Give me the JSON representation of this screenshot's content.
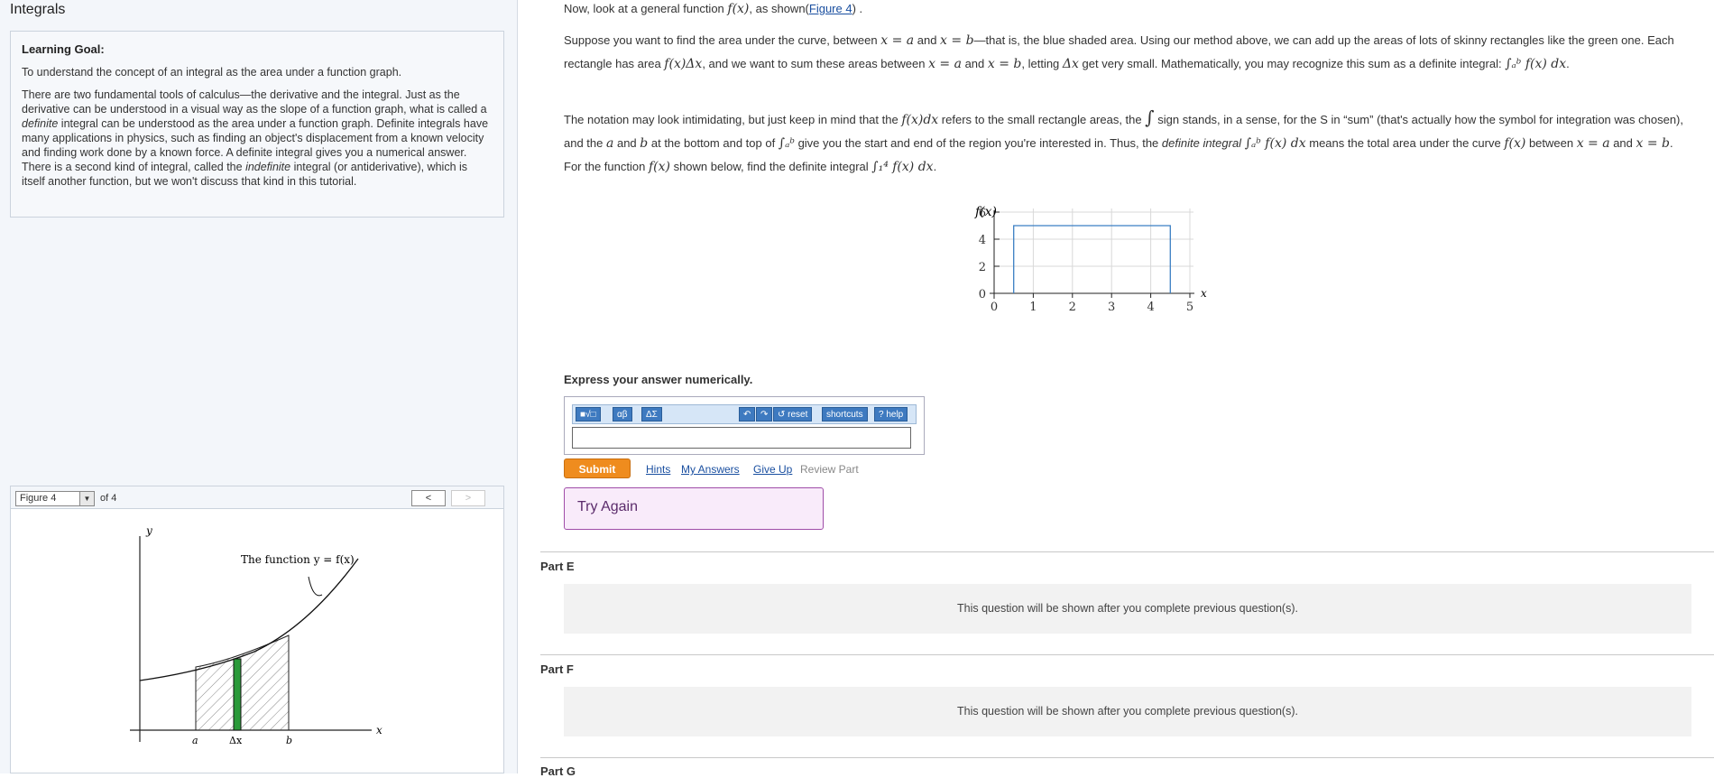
{
  "page": {
    "title": "Integrals"
  },
  "learning_goal": {
    "heading": "Learning Goal:",
    "line1": "To understand the concept of an integral as the area under a function graph.",
    "para_a": "There are two fundamental tools of calculus—the derivative and the integral. Just as the derivative can be understood in a visual way as the slope of a function graph, what is called a ",
    "definite": "definite",
    "para_b": " integral can be understood as the area under a function graph. Definite integrals have many applications in physics, such as finding an object's displacement from a known velocity and finding work done by a known force. A definite integral gives you a numerical answer. There is a second kind of integral, called the ",
    "indefinite": "indefinite",
    "para_c": " integral (or antiderivative), which is itself another function, but we won't discuss that kind in this tutorial."
  },
  "figure_nav": {
    "selected": "Figure 4",
    "of_label": "of 4",
    "prev": "<",
    "next": ">"
  },
  "figure4": {
    "function_label": "The function y = f(x)",
    "y_label": "y",
    "x_label": "x",
    "a_label": "a",
    "dx_label": "Δx",
    "b_label": "b"
  },
  "question": {
    "intro_a": "Now, look at a general function ",
    "intro_fx": "f(x)",
    "intro_b": ", as shown(",
    "intro_link": "Figure 4",
    "intro_c": ") .",
    "p2_1": "Suppose you want to find the area under the curve, between ",
    "p2_xa": "x = a",
    "p2_2": " and ",
    "p2_xb": "x = b",
    "p2_3": "—that is, the blue shaded area. Using our method above, we can add up the areas of lots of skinny rectangles like the green one. Each rectangle has area ",
    "p2_fdx": "f(x)Δx",
    "p2_4": ", and we want to sum these areas between ",
    "p2_xa2": "x = a",
    "p2_5": " and ",
    "p2_xb2": "x = b",
    "p2_6": ", letting ",
    "p2_dx": "Δx",
    "p2_7": " get very small. Mathematically, you may recognize this sum as a definite integral: ",
    "p2_int": "∫ₐᵇ f(x) dx",
    "p2_8": ".",
    "p3_1": "The notation may look intimidating, but just keep in mind that the ",
    "p3_fdx": "f(x)dx",
    "p3_2": " refers to the small rectangle areas, the ",
    "p3_int": "∫",
    "p3_3": " sign stands, in a sense, for the S in “sum” (that's actually how the symbol for integration was chosen), and the ",
    "p3_a": "a",
    "p3_4": " and ",
    "p3_b": "b",
    "p3_5": " at the bottom and top of ",
    "p3_int2": "∫ₐᵇ",
    "p3_6": " give you the start and end of the region you're interested in. Thus, the ",
    "p3_def": "definite integral",
    "p3_int3": "∫ₐᵇ f(x) dx",
    "p3_7": " means the total area under the curve ",
    "p3_fx": "f(x)",
    "p3_8": " between ",
    "p3_xa": "x = a",
    "p3_9": " and ",
    "p3_xb": "x = b",
    "p3_10": ". For the function ",
    "p3_fx2": "f(x)",
    "p3_11": " shown below, find the definite integral ",
    "p3_int4": "∫₁⁴ f(x) dx",
    "p3_12": "."
  },
  "chart_data": {
    "type": "line",
    "ylabel": "f(x)",
    "xlabel": "x",
    "xlim": [
      0,
      5
    ],
    "ylim": [
      0,
      6
    ],
    "x_ticks": [
      "0",
      "1",
      "2",
      "3",
      "4",
      "5"
    ],
    "y_ticks": [
      "0",
      "2",
      "4",
      "6"
    ],
    "grid": true,
    "series": [
      {
        "x": [
          0.5,
          0.5,
          4.5,
          4.5
        ],
        "y": [
          0,
          5,
          5,
          0
        ]
      }
    ],
    "color": "#3b7fc4"
  },
  "answer": {
    "prompt": "Express your answer numerically.",
    "toolbar": [
      "■√□",
      "αβ",
      "ΔΣ",
      "↶",
      "↷",
      "↺ reset",
      "shortcuts",
      "? help"
    ],
    "submit": "Submit",
    "hints": "Hints",
    "my_answers": "My Answers",
    "give_up": "Give Up",
    "review": "Review Part",
    "feedback": "Try Again"
  },
  "parts": [
    {
      "label": "Part E",
      "message": "This question will be shown after you complete previous question(s)."
    },
    {
      "label": "Part F",
      "message": "This question will be shown after you complete previous question(s)."
    },
    {
      "label": "Part G"
    }
  ],
  "colors": {
    "link": "#1a4fa0",
    "submit": "#ef8c1e",
    "try_again_bg": "#f9ebfa",
    "green_strip": "#2a9a3a"
  }
}
